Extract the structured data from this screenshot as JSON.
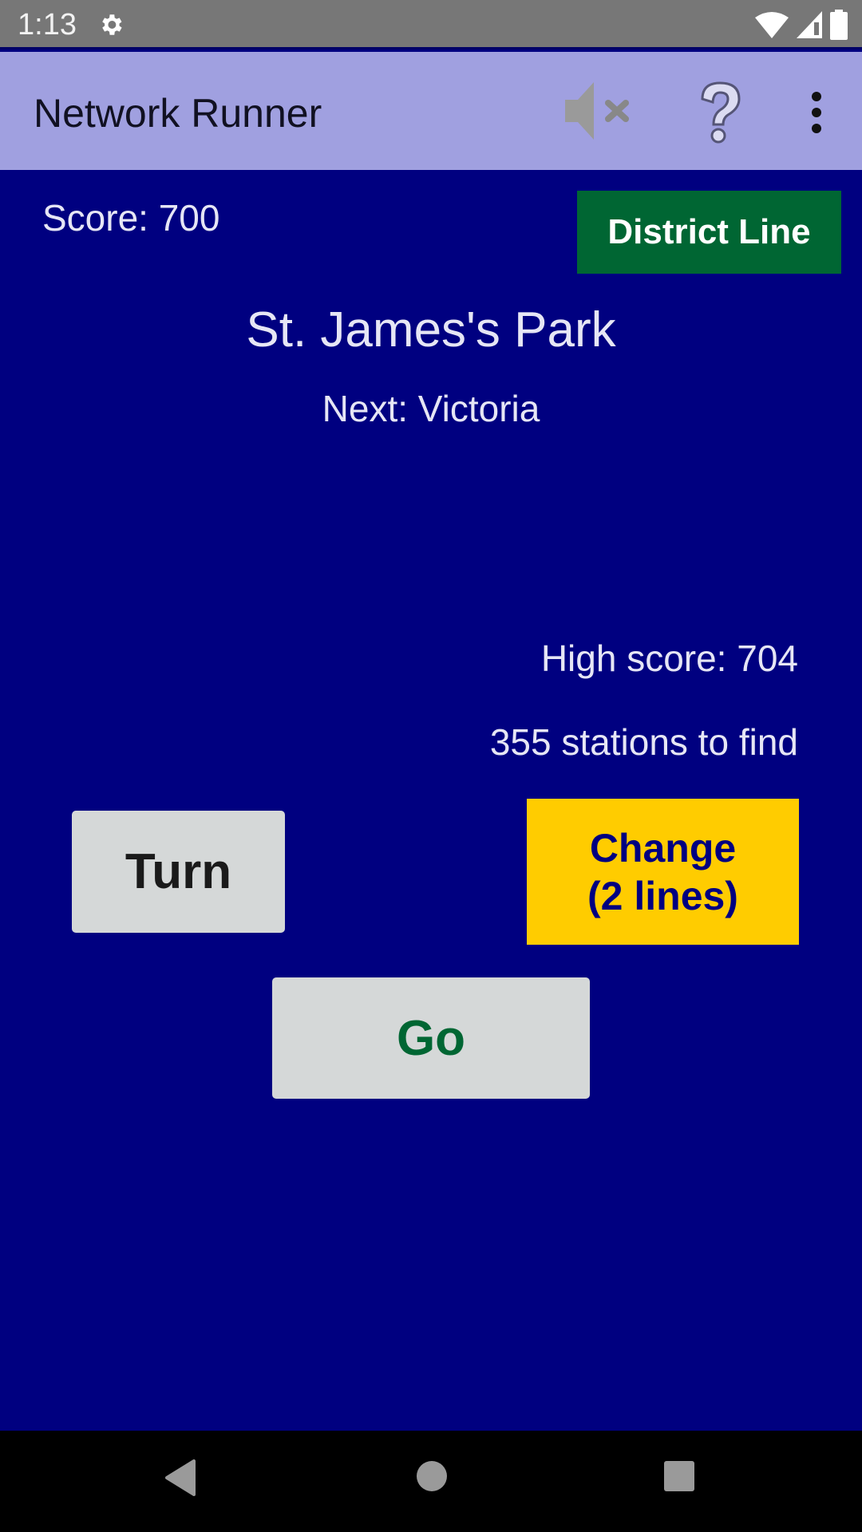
{
  "status_bar": {
    "time": "1:13",
    "icons": [
      "gear-icon",
      "wifi-icon",
      "signal-icon",
      "battery-icon"
    ]
  },
  "app_bar": {
    "title": "Network Runner",
    "actions": [
      "mute-icon",
      "help-icon",
      "more-vert-icon"
    ]
  },
  "game": {
    "score_text": "Score: 700",
    "line_name": "District Line",
    "current_station": "St. James's Park",
    "next_station_text": "Next: Victoria",
    "high_score_text": "High score: 704",
    "stations_remaining_text": "355 stations to find"
  },
  "controls": {
    "turn_label": "Turn",
    "change_label": "Change\n(2 lines)",
    "go_label": "Go"
  },
  "colors": {
    "background": "#000080",
    "app_bar": "#a0a0e0",
    "district_line": "#006633",
    "change_button": "#ffcc00",
    "button_grey": "#d5d8d8"
  },
  "nav_bar": {
    "buttons": [
      "back-icon",
      "home-icon",
      "recents-icon"
    ]
  }
}
